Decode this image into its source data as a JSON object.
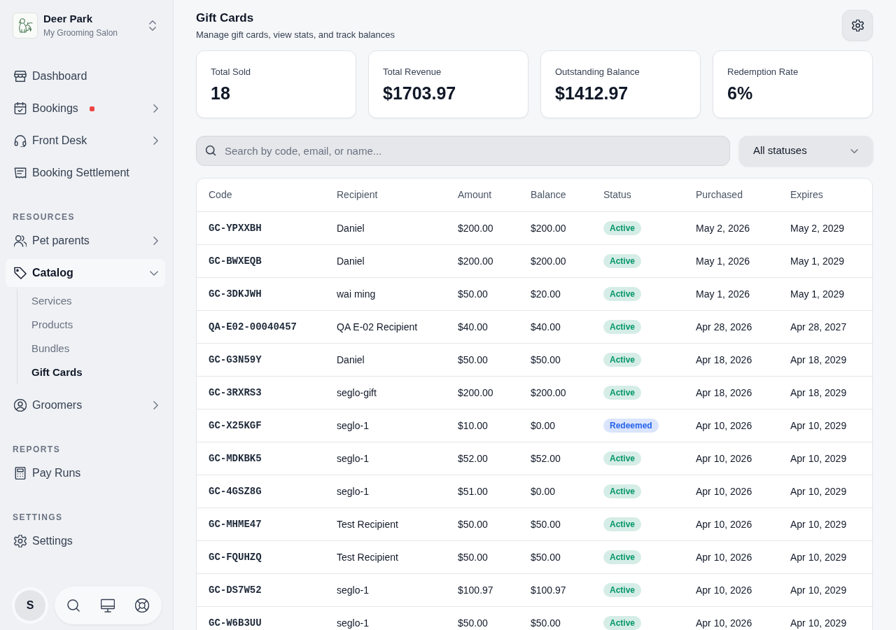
{
  "sidebar": {
    "workspace": {
      "name": "Deer Park",
      "subtitle": "My Grooming Salon"
    },
    "sections": [
      {
        "items": [
          {
            "label": "Dashboard",
            "kind": "link",
            "selected": false,
            "alert": false
          },
          {
            "label": "Bookings",
            "kind": "group",
            "expanded": false,
            "selected": false,
            "alert": true
          },
          {
            "label": "Front Desk",
            "kind": "group",
            "expanded": false,
            "selected": false,
            "alert": false
          },
          {
            "label": "Booking Settlement",
            "kind": "link",
            "selected": false,
            "alert": false
          }
        ]
      },
      {
        "title": "RESOURCES",
        "items": [
          {
            "label": "Pet parents",
            "kind": "group",
            "expanded": false,
            "selected": false,
            "alert": false
          },
          {
            "label": "Catalog",
            "kind": "group",
            "expanded": true,
            "selected": true,
            "alert": false,
            "children": [
              {
                "label": "Services",
                "selected": false
              },
              {
                "label": "Products",
                "selected": false
              },
              {
                "label": "Bundles",
                "selected": false
              },
              {
                "label": "Gift Cards",
                "selected": true
              }
            ]
          },
          {
            "label": "Groomers",
            "kind": "group",
            "expanded": false,
            "selected": false,
            "alert": false
          }
        ]
      },
      {
        "title": "REPORTS",
        "items": [
          {
            "label": "Pay Runs",
            "kind": "link",
            "selected": false,
            "alert": false
          }
        ]
      },
      {
        "title": "SETTINGS",
        "items": [
          {
            "label": "Settings",
            "kind": "link",
            "selected": false,
            "alert": false
          }
        ]
      }
    ],
    "user": {
      "initial": "S"
    }
  },
  "header": {
    "title": "Gift Cards",
    "subtitle": "Manage gift cards, view stats, and track balances"
  },
  "stats": [
    {
      "label": "Total Sold",
      "value": "18"
    },
    {
      "label": "Total Revenue",
      "value": "$1703.97"
    },
    {
      "label": "Outstanding Balance",
      "value": "$1412.97"
    },
    {
      "label": "Redemption Rate",
      "value": "6%"
    }
  ],
  "search": {
    "placeholder": "Search by code, email, or name..."
  },
  "status_filter": {
    "value": "All statuses"
  },
  "table": {
    "columns": [
      "Code",
      "Recipient",
      "Amount",
      "Balance",
      "Status",
      "Purchased",
      "Expires"
    ],
    "rows": [
      {
        "code": "GC-YPXXBH",
        "recipient": "Daniel",
        "amount": "$200.00",
        "balance": "$200.00",
        "status": {
          "label": "Active",
          "color": "#059669"
        },
        "purchased": "May 2, 2026",
        "expires": "May 2, 2029"
      },
      {
        "code": "GC-BWXEQB",
        "recipient": "Daniel",
        "amount": "$200.00",
        "balance": "$200.00",
        "status": {
          "label": "Active",
          "color": "#059669"
        },
        "purchased": "May 1, 2026",
        "expires": "May 1, 2029"
      },
      {
        "code": "GC-3DKJWH",
        "recipient": "wai ming",
        "amount": "$50.00",
        "balance": "$20.00",
        "status": {
          "label": "Active",
          "color": "#059669"
        },
        "purchased": "May 1, 2026",
        "expires": "May 1, 2029"
      },
      {
        "code": "QA-E02-00040457",
        "recipient": "QA E-02 Recipient",
        "amount": "$40.00",
        "balance": "$40.00",
        "status": {
          "label": "Active",
          "color": "#059669"
        },
        "purchased": "Apr 28, 2026",
        "expires": "Apr 28, 2027"
      },
      {
        "code": "GC-G3N59Y",
        "recipient": "Daniel",
        "amount": "$50.00",
        "balance": "$50.00",
        "status": {
          "label": "Active",
          "color": "#059669"
        },
        "purchased": "Apr 18, 2026",
        "expires": "Apr 18, 2029"
      },
      {
        "code": "GC-3RXRS3",
        "recipient": "seglo-gift",
        "amount": "$200.00",
        "balance": "$200.00",
        "status": {
          "label": "Active",
          "color": "#059669"
        },
        "purchased": "Apr 18, 2026",
        "expires": "Apr 18, 2029"
      },
      {
        "code": "GC-X25KGF",
        "recipient": "seglo-1",
        "amount": "$10.00",
        "balance": "$0.00",
        "status": {
          "label": "Redeemed",
          "color": "#2563eb"
        },
        "purchased": "Apr 10, 2026",
        "expires": "Apr 10, 2029"
      },
      {
        "code": "GC-MDKBK5",
        "recipient": "seglo-1",
        "amount": "$52.00",
        "balance": "$52.00",
        "status": {
          "label": "Active",
          "color": "#059669"
        },
        "purchased": "Apr 10, 2026",
        "expires": "Apr 10, 2029"
      },
      {
        "code": "GC-4GSZ8G",
        "recipient": "seglo-1",
        "amount": "$51.00",
        "balance": "$0.00",
        "status": {
          "label": "Active",
          "color": "#059669"
        },
        "purchased": "Apr 10, 2026",
        "expires": "Apr 10, 2029"
      },
      {
        "code": "GC-MHME47",
        "recipient": "Test Recipient",
        "amount": "$50.00",
        "balance": "$50.00",
        "status": {
          "label": "Active",
          "color": "#059669"
        },
        "purchased": "Apr 10, 2026",
        "expires": "Apr 10, 2029"
      },
      {
        "code": "GC-FQUHZQ",
        "recipient": "Test Recipient",
        "amount": "$50.00",
        "balance": "$50.00",
        "status": {
          "label": "Active",
          "color": "#059669"
        },
        "purchased": "Apr 10, 2026",
        "expires": "Apr 10, 2029"
      },
      {
        "code": "GC-DS7W52",
        "recipient": "seglo-1",
        "amount": "$100.97",
        "balance": "$100.97",
        "status": {
          "label": "Active",
          "color": "#059669"
        },
        "purchased": "Apr 10, 2026",
        "expires": "Apr 10, 2029"
      },
      {
        "code": "GC-W6B3UU",
        "recipient": "seglo-1",
        "amount": "$50.00",
        "balance": "$50.00",
        "status": {
          "label": "Active",
          "color": "#059669"
        },
        "purchased": "Apr 10, 2026",
        "expires": "Apr 10, 2029"
      }
    ]
  }
}
